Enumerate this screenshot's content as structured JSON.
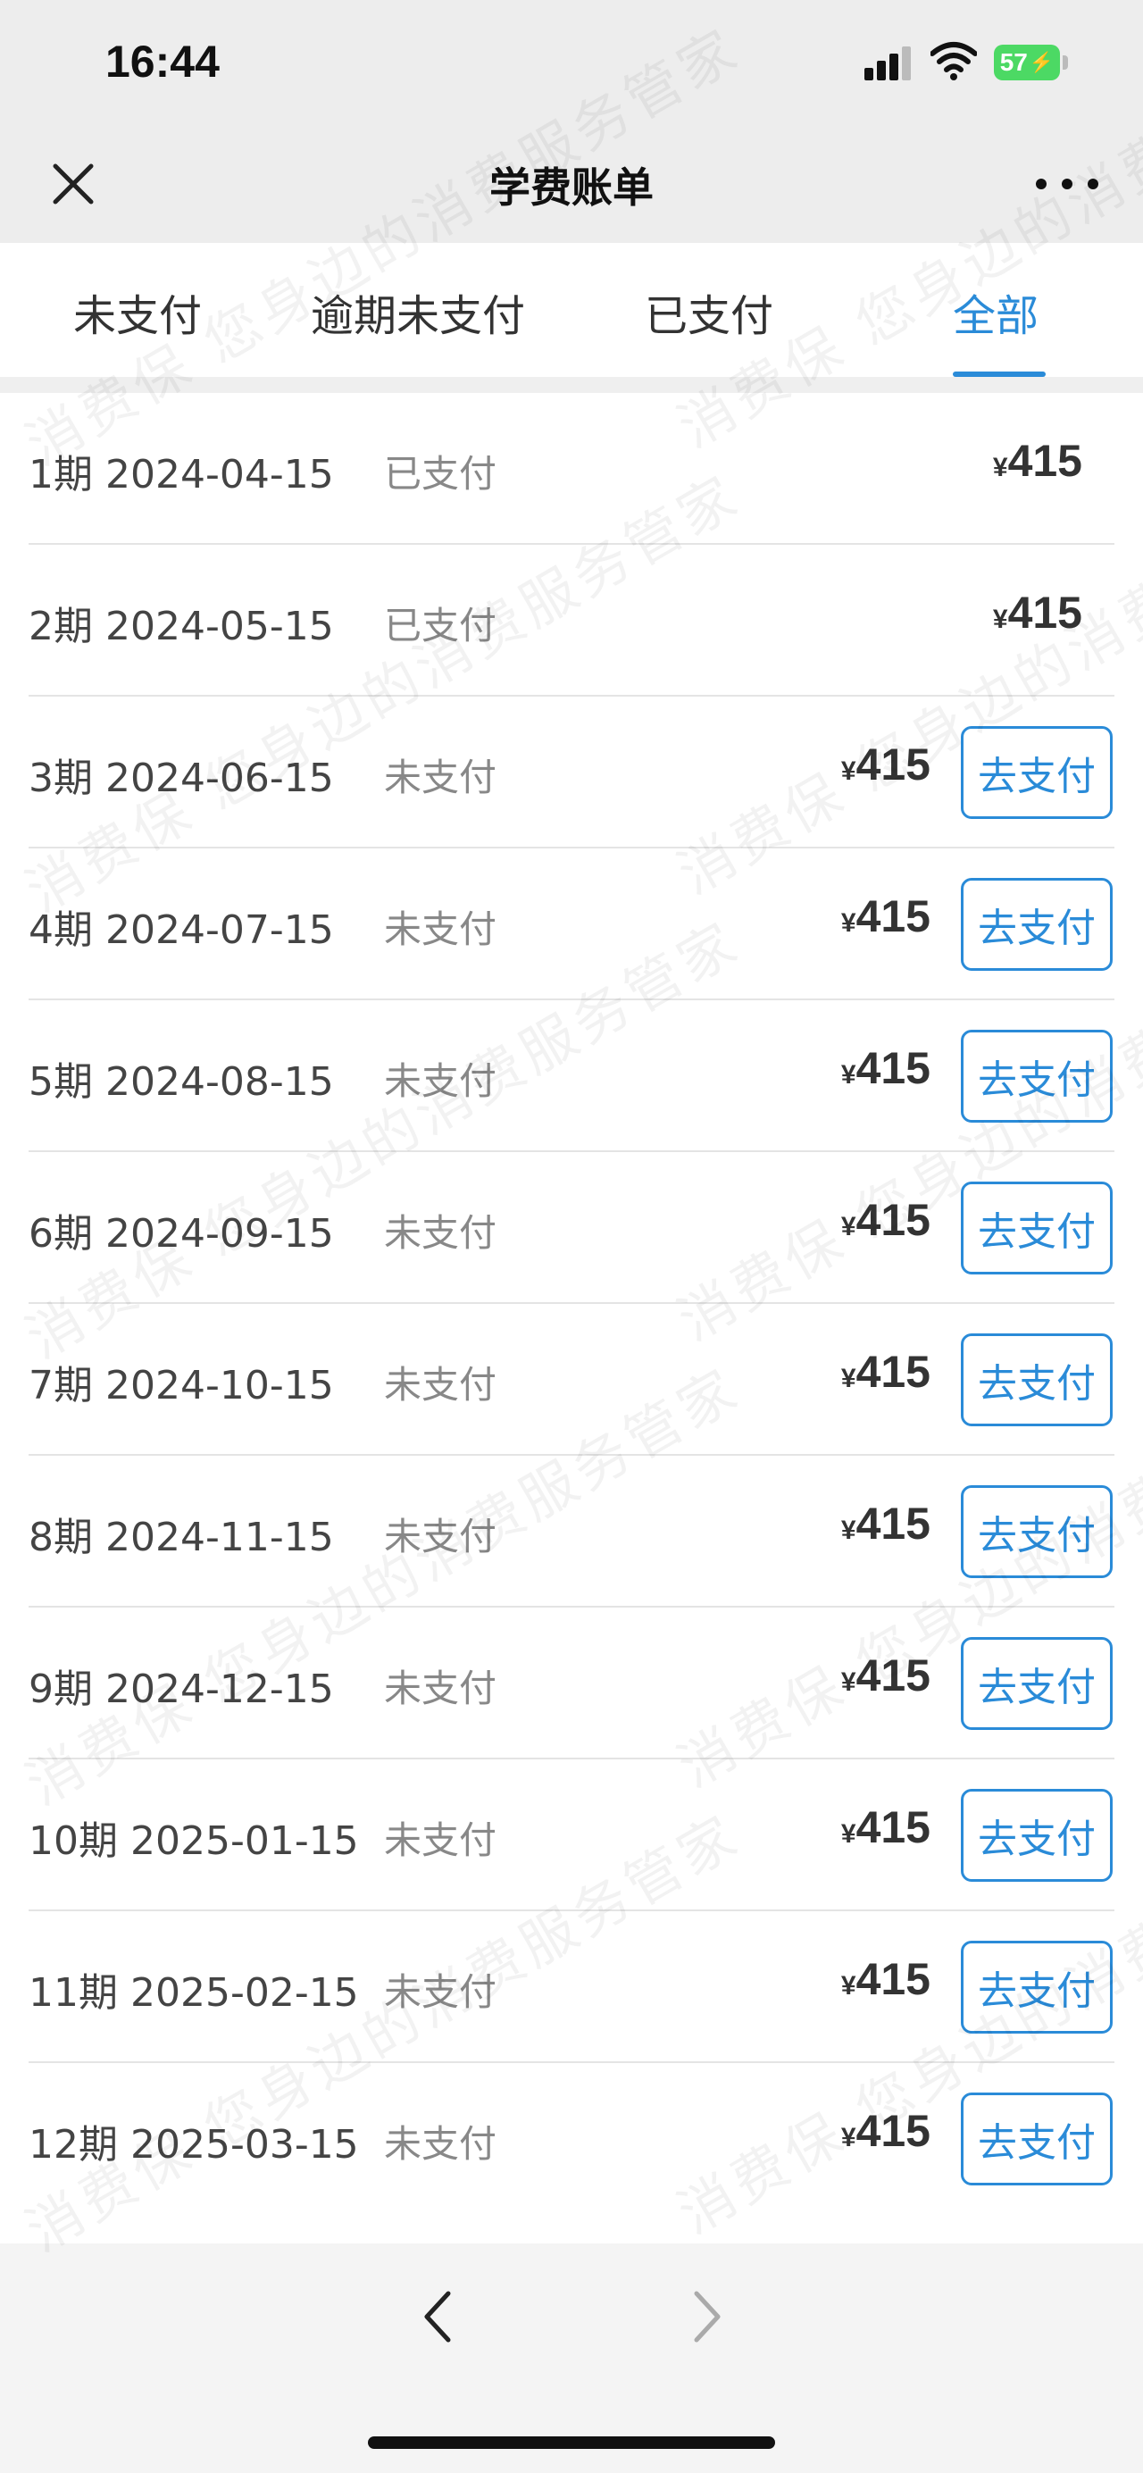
{
  "status_bar": {
    "time": "16:44",
    "battery": "57"
  },
  "nav": {
    "title": "学费账单"
  },
  "tabs": [
    {
      "label": "未支付",
      "active": false
    },
    {
      "label": "逾期未支付",
      "active": false
    },
    {
      "label": "已支付",
      "active": false
    },
    {
      "label": "全部",
      "active": true
    }
  ],
  "currency": "¥",
  "bills": [
    {
      "period": "1期 2024-04-15",
      "status": "已支付",
      "amount": "415",
      "pay_label": ""
    },
    {
      "period": "2期 2024-05-15",
      "status": "已支付",
      "amount": "415",
      "pay_label": ""
    },
    {
      "period": "3期 2024-06-15",
      "status": "未支付",
      "amount": "415",
      "pay_label": "去支付"
    },
    {
      "period": "4期 2024-07-15",
      "status": "未支付",
      "amount": "415",
      "pay_label": "去支付"
    },
    {
      "period": "5期 2024-08-15",
      "status": "未支付",
      "amount": "415",
      "pay_label": "去支付"
    },
    {
      "period": "6期 2024-09-15",
      "status": "未支付",
      "amount": "415",
      "pay_label": "去支付"
    },
    {
      "period": "7期 2024-10-15",
      "status": "未支付",
      "amount": "415",
      "pay_label": "去支付"
    },
    {
      "period": "8期 2024-11-15",
      "status": "未支付",
      "amount": "415",
      "pay_label": "去支付"
    },
    {
      "period": "9期 2024-12-15",
      "status": "未支付",
      "amount": "415",
      "pay_label": "去支付"
    },
    {
      "period": "10期 2025-01-15",
      "status": "未支付",
      "amount": "415",
      "pay_label": "去支付"
    },
    {
      "period": "11期 2025-02-15",
      "status": "未支付",
      "amount": "415",
      "pay_label": "去支付"
    },
    {
      "period": "12期 2025-03-15",
      "status": "未支付",
      "amount": "415",
      "pay_label": "去支付"
    }
  ],
  "watermark": "消费保 您身边的消费服务管家",
  "colors": {
    "accent": "#2a8bd8",
    "battery": "#4cd964",
    "page_bg": "#ededed"
  },
  "icons": {
    "close": "close-icon",
    "more": "more-icon",
    "back": "chevron-left-icon",
    "forward": "chevron-right-icon",
    "signal": "signal-icon",
    "wifi": "wifi-icon",
    "battery": "battery-icon"
  }
}
